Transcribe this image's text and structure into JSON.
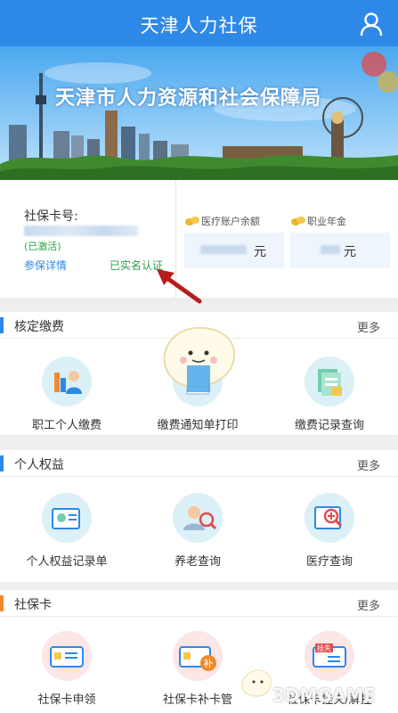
{
  "app": {
    "title": "天津人力社保"
  },
  "banner": {
    "text": "天津市人力资源和社会保障局"
  },
  "account": {
    "card_label": "社保卡号:",
    "activated": "(已激活)",
    "detail_link": "参保详情",
    "realname": "已实名认证",
    "medical_label": "医疗账户余额",
    "medical_unit": "元",
    "pension_label": "职业年金",
    "pension_unit": "元"
  },
  "sections": [
    {
      "title": "核定缴费",
      "more": "更多",
      "accent": "#2e88e8",
      "items": [
        {
          "label": "职工个人缴费"
        },
        {
          "label": "缴费通知单打印"
        },
        {
          "label": "缴费记录查询"
        }
      ]
    },
    {
      "title": "个人权益",
      "more": "更多",
      "accent": "#2e88e8",
      "items": [
        {
          "label": "个人权益记录单"
        },
        {
          "label": "养老查询"
        },
        {
          "label": "医疗查询"
        }
      ]
    },
    {
      "title": "社保卡",
      "more": "更多",
      "accent": "#f08a2c",
      "items": [
        {
          "label": "社保卡申领"
        },
        {
          "label": "社保卡补卡管"
        },
        {
          "label": "社保卡挂失/解挂"
        }
      ]
    }
  ],
  "stamps": {
    "mend": "补",
    "loss": "挂失"
  },
  "watermark": "3DMGAME",
  "colors": {
    "primary": "#2e88e8",
    "green": "#2ea04a",
    "orange": "#f08a2c",
    "arrow": "#b51e1e"
  }
}
